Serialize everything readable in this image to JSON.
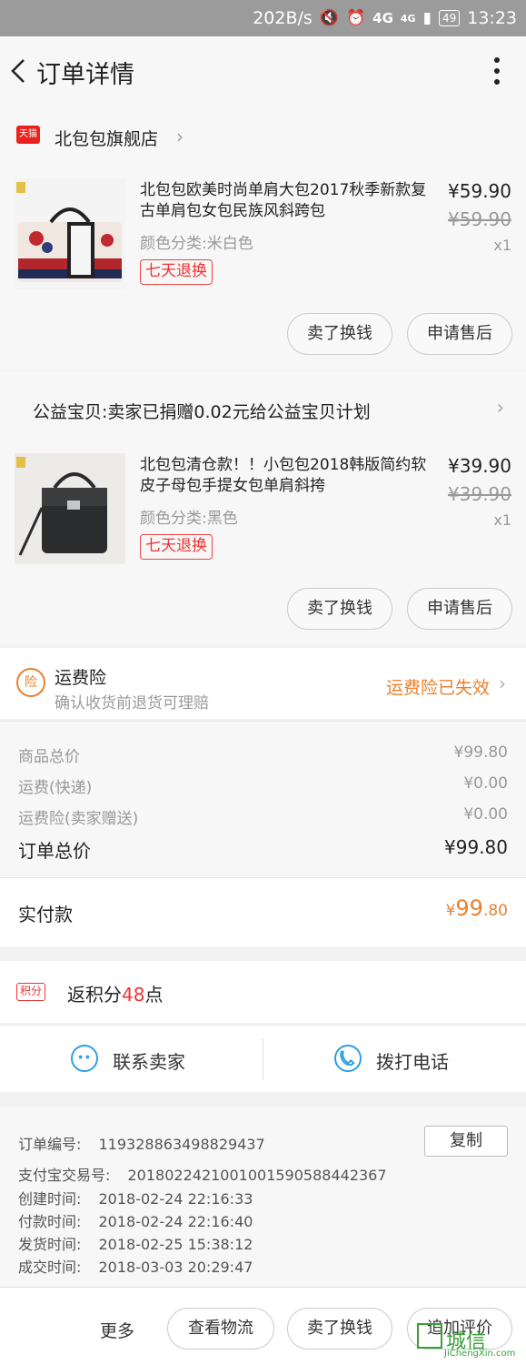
{
  "status_bar": {
    "speed": "202B/s",
    "network": "4G",
    "network2": "4G",
    "battery": "49",
    "time": "13:23"
  },
  "header": {
    "title": "订单详情"
  },
  "store": {
    "badge": "天猫",
    "name": "北包包旗舰店"
  },
  "items": [
    {
      "title": "北包包欧美时尚单肩大包2017秋季新款复古单肩包女包民族风斜跨包",
      "spec": "颜色分类:米白色",
      "tag": "七天退换",
      "price": "¥59.90",
      "original_price": "¥59.90",
      "qty": "x1",
      "btn_sell": "卖了换钱",
      "btn_after_sale": "申请售后"
    },
    {
      "title": "北包包清仓款！！小包包2018韩版简约软皮子母包手提女包单肩斜挎",
      "spec": "颜色分类:黑色",
      "tag": "七天退换",
      "price": "¥39.90",
      "original_price": "¥39.90",
      "qty": "x1",
      "btn_sell": "卖了换钱",
      "btn_after_sale": "申请售后"
    }
  ],
  "charity": {
    "text": "公益宝贝:卖家已捐赠0.02元给公益宝贝计划"
  },
  "freight_insurance": {
    "icon_text": "险",
    "title": "运费险",
    "subtitle": "确认收货前退货可理赔",
    "status": "运费险已失效"
  },
  "summary": {
    "goods_total_label": "商品总价",
    "goods_total": "¥99.80",
    "shipping_label": "运费(快递)",
    "shipping": "¥0.00",
    "insurance_label": "运费险(卖家赠送)",
    "insurance": "¥0.00",
    "order_total_label": "订单总价",
    "order_total": "¥99.80"
  },
  "paid": {
    "label": "实付款",
    "currency": "¥",
    "amount_int": "99",
    "amount_dec": ".80"
  },
  "points": {
    "badge": "积分",
    "prefix": "返积分",
    "value": "48",
    "suffix": "点"
  },
  "contact": {
    "seller": "联系卖家",
    "phone": "拨打电话"
  },
  "order_info": {
    "order_no_label": "订单编号:",
    "order_no": "119328863498829437",
    "copy": "复制",
    "alipay_label": "支付宝交易号:",
    "alipay_no": "2018022421001001590588442367",
    "created_label": "创建时间:",
    "created": "2018-02-24 22:16:33",
    "paid_label": "付款时间:",
    "paid": "2018-02-24 22:16:40",
    "shipped_label": "发货时间:",
    "shipped": "2018-02-25 15:38:12",
    "completed_label": "成交时间:",
    "completed": "2018-03-03 20:29:47"
  },
  "bottom_bar": {
    "more": "更多",
    "logistics": "查看物流",
    "sell": "卖了换钱",
    "review": "追加评价"
  },
  "watermark": {
    "text": "城信",
    "url": "JiChengXin.com"
  },
  "colors": {
    "accent_orange": "#e9812e",
    "tmall_red": "#e8231f",
    "contact_blue": "#2f9fe0"
  }
}
